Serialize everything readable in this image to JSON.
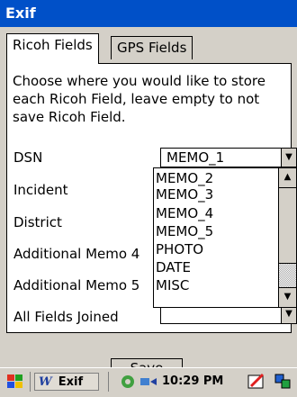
{
  "window": {
    "title": "Exif"
  },
  "tabs": [
    {
      "label": "Ricoh Fields",
      "active": true
    },
    {
      "label": "GPS Fields",
      "active": false
    }
  ],
  "instructions": "Choose where you would like to store each Ricoh Field, leave empty to not save Ricoh Field.",
  "fields": [
    {
      "label": "DSN"
    },
    {
      "label": "Incident"
    },
    {
      "label": "District"
    },
    {
      "label": "Additional Memo 4"
    },
    {
      "label": "Additional Memo 5"
    },
    {
      "label": "All Fields Joined"
    }
  ],
  "dsn_combo": {
    "value": "MEMO_1"
  },
  "dropdown": {
    "options": [
      "MEMO_2",
      "MEMO_3",
      "MEMO_4",
      "MEMO_5",
      "PHOTO",
      "DATE",
      "MISC"
    ]
  },
  "save_button": {
    "label": "Save"
  },
  "taskbar": {
    "app_label": "Exif",
    "time": "10:29 PM"
  },
  "colors": {
    "titlebar": "#0050c8",
    "face": "#d4d0c8"
  }
}
